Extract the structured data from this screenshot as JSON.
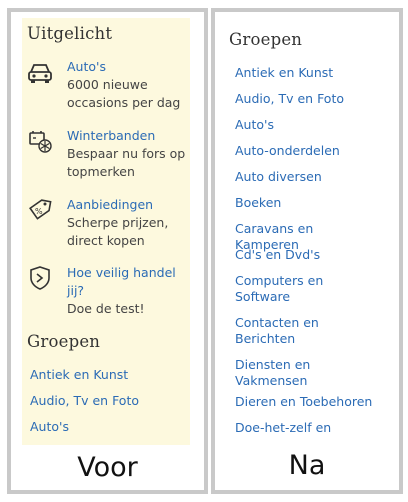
{
  "before": {
    "caption": "Voor",
    "highlights_title": "Uitgelicht",
    "highlights": [
      {
        "icon": "car-icon",
        "title": "Auto's",
        "desc": "6000 nieuwe occasions per dag"
      },
      {
        "icon": "snow-battery-icon",
        "title": "Winterbanden",
        "desc": "Bespaar nu fors op topmerken"
      },
      {
        "icon": "discount-tag-icon",
        "title": "Aanbiedingen",
        "desc": "Scherpe prijzen, direct kopen"
      },
      {
        "icon": "safety-shield-icon",
        "title": "Hoe veilig handel jij?",
        "desc": "Doe de test!"
      }
    ],
    "groups_title": "Groepen",
    "groups": [
      "Antiek en Kunst",
      "Audio, Tv en Foto",
      "Auto's"
    ]
  },
  "after": {
    "caption": "Na",
    "groups_title": "Groepen",
    "groups": [
      "Antiek en Kunst",
      "Audio, Tv en Foto",
      "Auto's",
      "Auto-onderdelen",
      "Auto diversen",
      "Boeken",
      "Caravans en Kamperen",
      "Cd's en Dvd's",
      "Computers en Software",
      "Contacten en Berichten",
      "Diensten en Vakmensen",
      "Dieren en Toebehoren",
      "Doe-het-zelf en Verbouw"
    ]
  },
  "colors": {
    "link": "#2b6bb5",
    "highlight_bg": "#fdf9de",
    "border": "#c9c9c9"
  }
}
